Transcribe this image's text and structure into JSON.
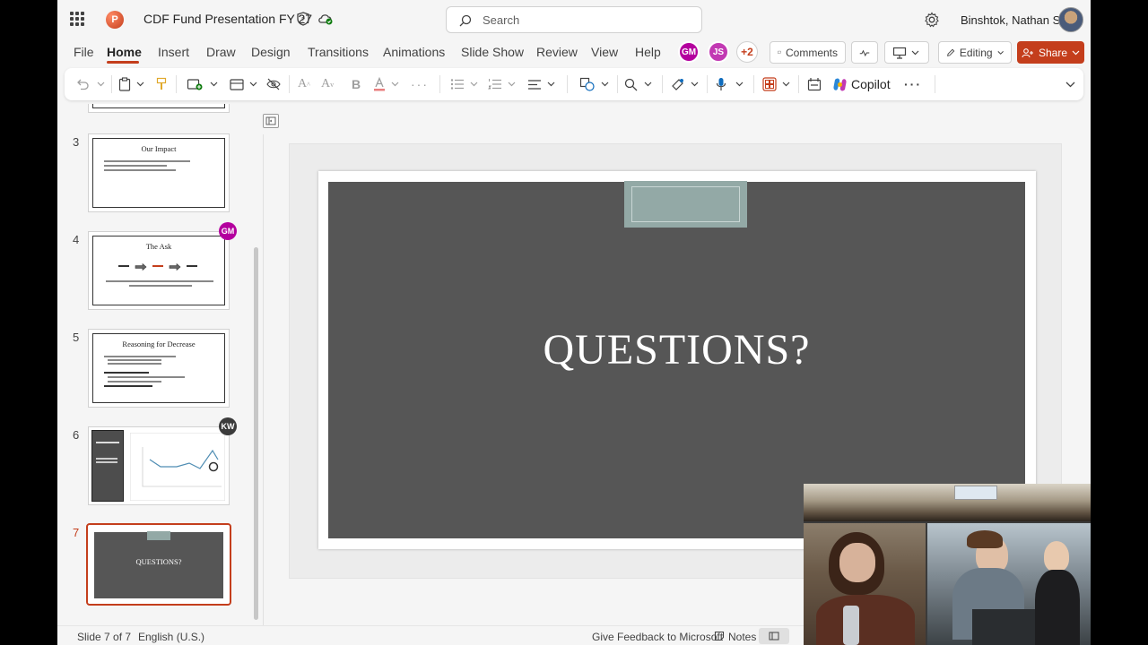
{
  "app": {
    "doc_title": "CDF Fund Presentation FY 27",
    "search_placeholder": "Search",
    "user_name": "Binshtok, Nathan S",
    "app_icon_letter": "P"
  },
  "menu": {
    "items": [
      "File",
      "Home",
      "Insert",
      "Draw",
      "Design",
      "Transitions",
      "Animations",
      "Slide Show",
      "Review",
      "View",
      "Help"
    ],
    "active": "Home",
    "collaborators": [
      {
        "initials": "GM",
        "color": "#b4009e"
      },
      {
        "initials": "JS",
        "color": "#c239b3"
      }
    ],
    "more_collaborators": "+2",
    "comments_label": "Comments",
    "editing_label": "Editing",
    "share_label": "Share"
  },
  "ribbon": {
    "copilot_label": "Copilot"
  },
  "thumbnails": [
    {
      "num": "3",
      "title": "Our Impact"
    },
    {
      "num": "4",
      "title": "The Ask",
      "badge": "GM",
      "badge_color": "#b4009e"
    },
    {
      "num": "5",
      "title": "Reasoning for Decrease"
    },
    {
      "num": "6",
      "title": "",
      "badge": "KW",
      "badge_color": "#3b3b3b"
    },
    {
      "num": "7",
      "title": "QUESTIONS?"
    }
  ],
  "slide": {
    "title": "QUESTIONS?"
  },
  "status": {
    "slide_indicator": "Slide 7 of 7",
    "language": "English (U.S.)",
    "feedback": "Give Feedback to Microsoft",
    "notes": "Notes"
  }
}
